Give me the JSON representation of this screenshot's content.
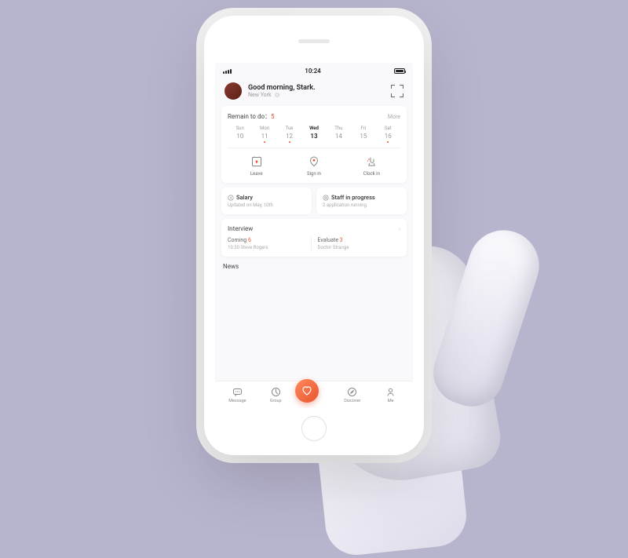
{
  "status": {
    "time": "10:24"
  },
  "header": {
    "greeting": "Good morning, Stark.",
    "location": "New York"
  },
  "todo": {
    "label": "Remain to do：",
    "count": "5",
    "more": "More",
    "days": [
      {
        "name": "Sun",
        "num": "10",
        "dot": false,
        "active": false
      },
      {
        "name": "Mon",
        "num": "11",
        "dot": true,
        "active": false
      },
      {
        "name": "Tue",
        "num": "12",
        "dot": true,
        "active": false
      },
      {
        "name": "Wed",
        "num": "13",
        "dot": false,
        "active": true
      },
      {
        "name": "Thu",
        "num": "14",
        "dot": false,
        "active": false
      },
      {
        "name": "Fri",
        "num": "15",
        "dot": false,
        "active": false
      },
      {
        "name": "Sat",
        "num": "16",
        "dot": true,
        "active": false
      }
    ],
    "actions": [
      {
        "label": "Leave"
      },
      {
        "label": "Sign in"
      },
      {
        "label": "Clock in"
      }
    ]
  },
  "salary": {
    "title": "Salary",
    "sub": "Updated on May, 10th"
  },
  "staff": {
    "title": "Staff in progress",
    "sub": "2 application running"
  },
  "interview": {
    "title": "Interview",
    "coming_label": "Coming",
    "coming_count": "6",
    "coming_sub": "10:30 Steve Rogers",
    "eval_label": "Evaluate",
    "eval_count": "3",
    "eval_sub": "Doctor Strange"
  },
  "news": {
    "title": "News"
  },
  "tabs": [
    {
      "label": "Message"
    },
    {
      "label": "Group"
    },
    {
      "label": ""
    },
    {
      "label": "Discover"
    },
    {
      "label": "Me"
    }
  ],
  "colors": {
    "accent": "#e8542e"
  }
}
